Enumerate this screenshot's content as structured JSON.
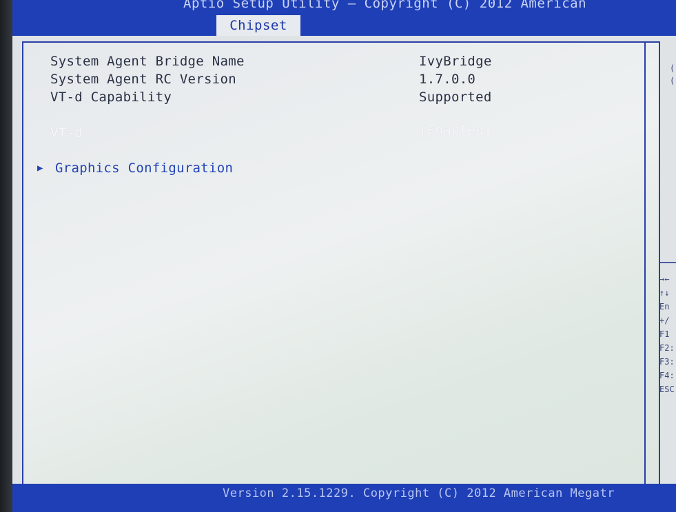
{
  "header": {
    "title": "Aptio Setup Utility – Copyright (C) 2012 American",
    "active_tab": "Chipset"
  },
  "main": {
    "items": [
      {
        "label": "System Agent Bridge Name",
        "value": "IvyBridge"
      },
      {
        "label": "System Agent RC Version",
        "value": "1.7.0.0"
      },
      {
        "label": "VT-d Capability",
        "value": "Supported"
      }
    ],
    "vtd": {
      "label": "VT-d",
      "value": "[Enabled]"
    },
    "submenu": {
      "label": "Graphics Configuration",
      "arrow": "▶"
    }
  },
  "help": {
    "top": [
      "(",
      "("
    ],
    "keys": [
      "→←",
      "↑↓",
      "En",
      "+/",
      "F1",
      "F2:",
      "F3:",
      "F4:",
      "ESC"
    ]
  },
  "footer": {
    "text": "Version 2.15.1229. Copyright (C) 2012 American Megatr"
  }
}
